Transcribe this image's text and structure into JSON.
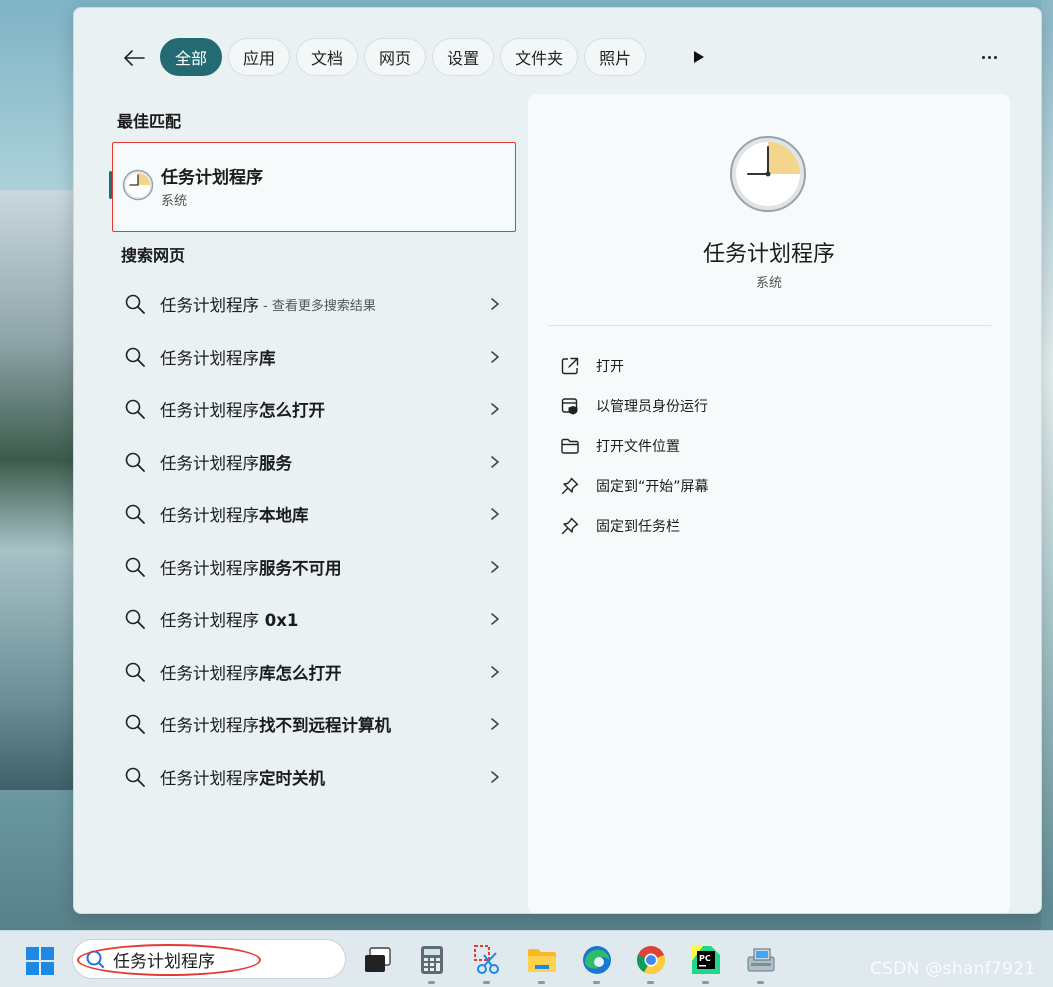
{
  "filters": {
    "back_label": "←",
    "chips": [
      "全部",
      "应用",
      "文档",
      "网页",
      "设置",
      "文件夹",
      "照片"
    ],
    "active_chip": "全部"
  },
  "best_match": {
    "heading": "最佳匹配",
    "title": "任务计划程序",
    "subtitle": "系统",
    "icon": "clock-icon"
  },
  "web_search": {
    "heading": "搜索网页",
    "items": [
      {
        "base": "任务计划程序",
        "bold": "",
        "hint": "- 查看更多搜索结果"
      },
      {
        "base": "任务计划程序",
        "bold": "库",
        "hint": ""
      },
      {
        "base": "任务计划程序",
        "bold": "怎么打开",
        "hint": ""
      },
      {
        "base": "任务计划程序",
        "bold": "服务",
        "hint": ""
      },
      {
        "base": "任务计划程序",
        "bold": "本地库",
        "hint": ""
      },
      {
        "base": "任务计划程序",
        "bold": "服务不可用",
        "hint": ""
      },
      {
        "base": "任务计划程序",
        "bold": " 0x1",
        "hint": ""
      },
      {
        "base": "任务计划程序",
        "bold": "库怎么打开",
        "hint": ""
      },
      {
        "base": "任务计划程序",
        "bold": "找不到远程计算机",
        "hint": ""
      },
      {
        "base": "任务计划程序",
        "bold": "定时关机",
        "hint": ""
      }
    ]
  },
  "detail": {
    "title": "任务计划程序",
    "subtitle": "系统",
    "actions": [
      {
        "label": "打开",
        "icon": "open-external-icon"
      },
      {
        "label": "以管理员身份运行",
        "icon": "admin-shield-icon"
      },
      {
        "label": "打开文件位置",
        "icon": "folder-icon"
      },
      {
        "label": "固定到“开始”屏幕",
        "icon": "pin-icon"
      },
      {
        "label": "固定到任务栏",
        "icon": "pin-icon"
      }
    ]
  },
  "taskbar": {
    "search_text": "任务计划程序",
    "apps": [
      "task-view-icon",
      "calculator-icon",
      "snipping-tool-icon",
      "file-explorer-icon",
      "edge-icon",
      "chrome-icon",
      "pycharm-icon",
      "network-icon"
    ]
  },
  "watermark": "CSDN @shanf7921",
  "colors": {
    "accent": "#246a73",
    "annotation": "#e53935"
  }
}
